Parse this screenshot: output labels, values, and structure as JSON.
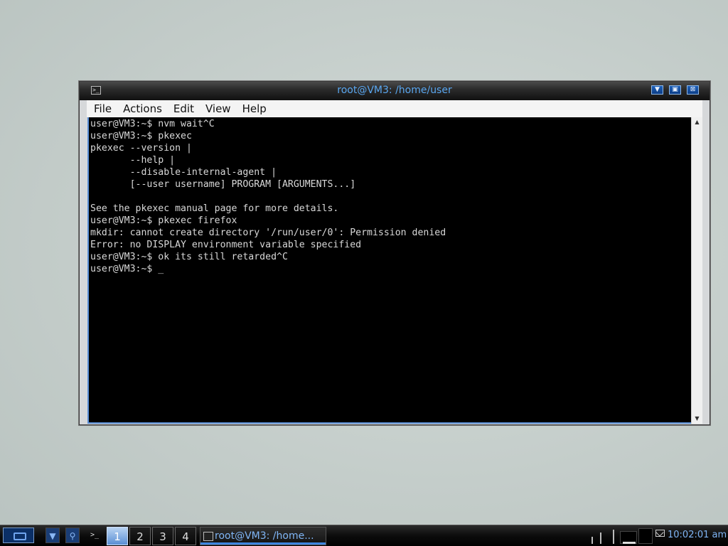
{
  "window": {
    "title": "root@VM3: /home/user",
    "menu": [
      "File",
      "Actions",
      "Edit",
      "View",
      "Help"
    ],
    "terminal_lines": [
      "user@VM3:~$ nvm wait^C",
      "user@VM3:~$ pkexec",
      "pkexec --version |",
      "       --help |",
      "       --disable-internal-agent |",
      "       [--user username] PROGRAM [ARGUMENTS...]",
      "",
      "See the pkexec manual page for more details.",
      "user@VM3:~$ pkexec firefox",
      "mkdir: cannot create directory '/run/user/0': Permission denied",
      "Error: no DISPLAY environment variable specified",
      "user@VM3:~$ ok its still retarded^C",
      "user@VM3:~$ _"
    ]
  },
  "taskbar": {
    "desktops": [
      "1",
      "2",
      "3",
      "4"
    ],
    "active_desktop": "1",
    "task_label": "root@VM3: /home...",
    "clock": "10:02:01 am"
  },
  "colors": {
    "accent": "#5aa7f0",
    "terminal_bg": "#000000",
    "terminal_fg": "#d8d8d8"
  },
  "icons": {
    "window": [
      "terminal-icon",
      "minimize-icon",
      "maximize-icon",
      "close-icon"
    ],
    "taskbar": [
      "start-menu-icon",
      "window-list-icon",
      "search-icon",
      "terminal-launcher-icon",
      "mail-icon"
    ]
  }
}
